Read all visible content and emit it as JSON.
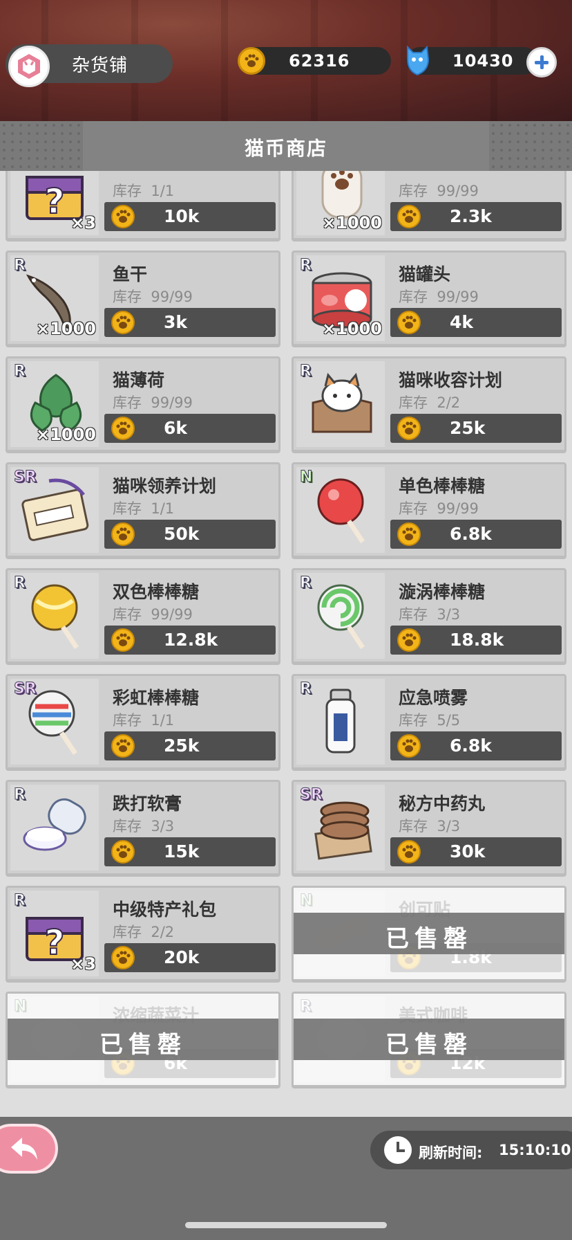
{
  "header": {
    "shop_name": "杂货铺",
    "coins": "62316",
    "gems": "10430"
  },
  "title": "猫币商店",
  "stock_label": "库存",
  "sold_out_label": "已售罄",
  "items": [
    {
      "name": "",
      "stock": "1/1",
      "price": "10k",
      "qty": "×3",
      "rarity": "",
      "icon": "mystery-chest-icon",
      "sold": false
    },
    {
      "name": "",
      "stock": "99/99",
      "price": "2.3k",
      "qty": "×1000",
      "rarity": "",
      "icon": "paw-can-icon",
      "sold": false
    },
    {
      "name": "鱼干",
      "stock": "99/99",
      "price": "3k",
      "qty": "×1000",
      "rarity": "R",
      "icon": "dried-fish-icon",
      "sold": false
    },
    {
      "name": "猫罐头",
      "stock": "99/99",
      "price": "4k",
      "qty": "×1000",
      "rarity": "R",
      "icon": "cat-can-icon",
      "sold": false
    },
    {
      "name": "猫薄荷",
      "stock": "99/99",
      "price": "6k",
      "qty": "×1000",
      "rarity": "R",
      "icon": "catnip-icon",
      "sold": false
    },
    {
      "name": "猫咪收容计划",
      "stock": "2/2",
      "price": "25k",
      "qty": "",
      "rarity": "R",
      "icon": "cat-box-icon",
      "sold": false
    },
    {
      "name": "猫咪领养计划",
      "stock": "1/1",
      "price": "50k",
      "qty": "",
      "rarity": "SR",
      "icon": "adoption-card-icon",
      "sold": false
    },
    {
      "name": "单色棒棒糖",
      "stock": "99/99",
      "price": "6.8k",
      "qty": "",
      "rarity": "N",
      "icon": "red-lollipop-icon",
      "sold": false
    },
    {
      "name": "双色棒棒糖",
      "stock": "99/99",
      "price": "12.8k",
      "qty": "",
      "rarity": "R",
      "icon": "yellow-lollipop-icon",
      "sold": false
    },
    {
      "name": "漩涡棒棒糖",
      "stock": "3/3",
      "price": "18.8k",
      "qty": "",
      "rarity": "R",
      "icon": "swirl-lollipop-icon",
      "sold": false
    },
    {
      "name": "彩虹棒棒糖",
      "stock": "1/1",
      "price": "25k",
      "qty": "",
      "rarity": "SR",
      "icon": "rainbow-lollipop-icon",
      "sold": false
    },
    {
      "name": "应急喷雾",
      "stock": "5/5",
      "price": "6.8k",
      "qty": "",
      "rarity": "R",
      "icon": "spray-bottle-icon",
      "sold": false
    },
    {
      "name": "跌打软膏",
      "stock": "3/3",
      "price": "15k",
      "qty": "",
      "rarity": "R",
      "icon": "ointment-icon",
      "sold": false
    },
    {
      "name": "秘方中药丸",
      "stock": "3/3",
      "price": "30k",
      "qty": "",
      "rarity": "SR",
      "icon": "herbal-pills-icon",
      "sold": false
    },
    {
      "name": "中级特产礼包",
      "stock": "2/2",
      "price": "20k",
      "qty": "×3",
      "rarity": "R",
      "icon": "mystery-chest-icon",
      "sold": false
    },
    {
      "name": "创可贴",
      "stock": "",
      "price": "1.8k",
      "qty": "",
      "rarity": "N",
      "icon": "bandage-icon",
      "sold": true
    },
    {
      "name": "浓缩蔬菜汁",
      "stock": "",
      "price": "6k",
      "qty": "",
      "rarity": "N",
      "icon": "veggie-juice-icon",
      "sold": true
    },
    {
      "name": "美式咖啡",
      "stock": "",
      "price": "12k",
      "qty": "",
      "rarity": "R",
      "icon": "coffee-icon",
      "sold": true
    }
  ],
  "footer": {
    "refresh_label": "刷新时间:",
    "refresh_time": "15:10:10"
  }
}
